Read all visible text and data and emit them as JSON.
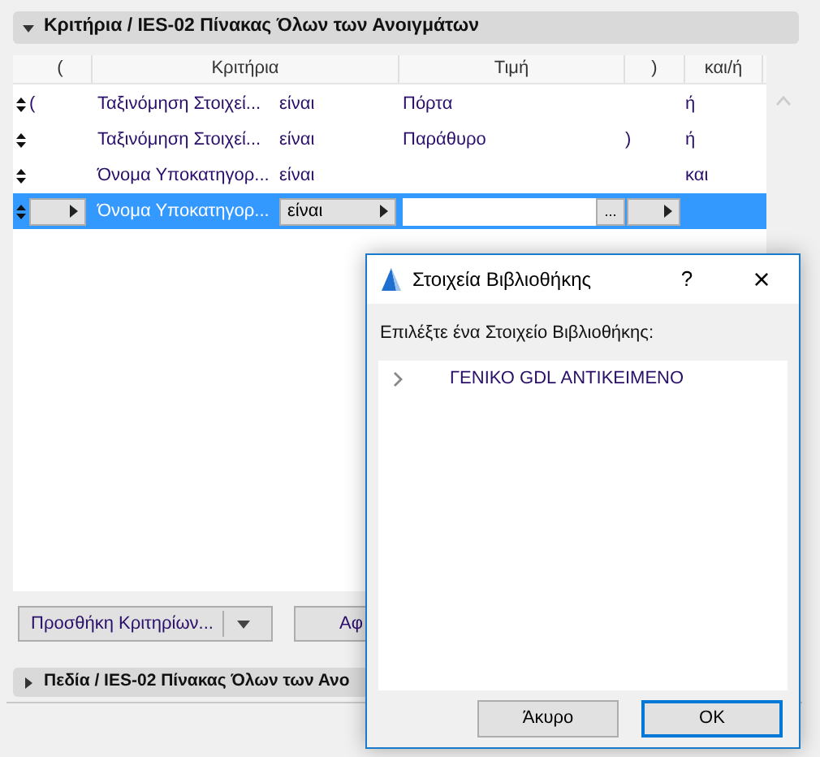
{
  "criteria_panel": {
    "title": "Κριτήρια / IES-02 Πίνακας Όλων των Ανοιγμάτων",
    "expanded": true
  },
  "table": {
    "columns": [
      "(",
      "Κριτήρια",
      "Τιμή",
      ")",
      "και/ή"
    ],
    "rows": [
      {
        "open": "(",
        "criterion": "Ταξινόμηση Στοιχεί...",
        "operator": "είναι",
        "value": "Πόρτα",
        "close": "",
        "conj": "ή",
        "selected": false
      },
      {
        "open": "",
        "criterion": "Ταξινόμηση Στοιχεί...",
        "operator": "είναι",
        "value": "Παράθυρο",
        "close": ")",
        "conj": "ή",
        "selected": false
      },
      {
        "open": "",
        "criterion": "Όνομα Υποκατηγορ...",
        "operator": "είναι",
        "value": "",
        "close": "",
        "conj": "και",
        "selected": false
      },
      {
        "open": "",
        "criterion": "Όνομα Υποκατηγορ...",
        "operator": "είναι",
        "value": "",
        "close": "",
        "selected": true,
        "browse": "..."
      }
    ]
  },
  "buttons": {
    "add": "Προσθήκη Κριτηρίων...",
    "second": "Αφ"
  },
  "fields_panel": {
    "title": "Πεδία / IES-02 Πίνακας Όλων των Ανο",
    "expanded": false
  },
  "dialog": {
    "title": "Στοιχεία Βιβλιοθήκης",
    "help": "?",
    "close": "×",
    "prompt": "Επιλέξτε ένα Στοιχείο Βιβλιοθήκης:",
    "items": [
      {
        "label": "ΓΕΝΙΚΟ GDL ΑΝΤΙΚΕΙΜΕΝΟ",
        "expanded": false
      }
    ],
    "buttons": [
      {
        "label": "Άκυρο",
        "default": false
      },
      {
        "label": "OK",
        "default": true
      }
    ]
  }
}
